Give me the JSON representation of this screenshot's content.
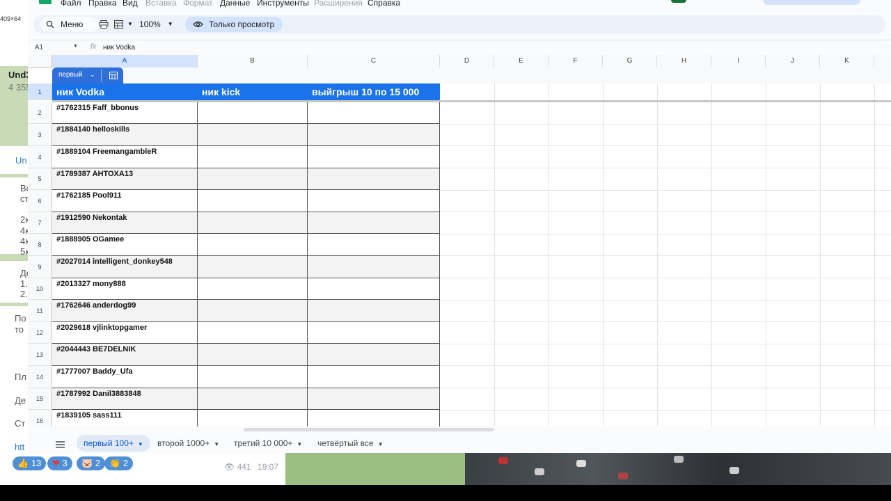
{
  "menu": [
    "Файл",
    "Правка",
    "Вид",
    "Вставка",
    "Формат",
    "Данные",
    "Инструменты",
    "Расширения",
    "Справка"
  ],
  "menu_disabled": [
    "Вставка",
    "Формат",
    "Расширения"
  ],
  "toolbar": {
    "search_label": "Меню",
    "zoom": "100%",
    "view_only_label": "Только просмотр"
  },
  "formula_bar": {
    "cell_ref": "A1",
    "fx": "fx",
    "value": "ник Vodka"
  },
  "columns": [
    "A",
    "B",
    "C",
    "D",
    "E",
    "F",
    "G",
    "H",
    "I",
    "J",
    "K"
  ],
  "table_chip": {
    "label": "первый"
  },
  "header": {
    "col_a": "ник Vodka",
    "col_b": "ник kick",
    "col_c": "выйгрыш 10 по 15 000"
  },
  "rows": [
    {
      "n": "1"
    },
    {
      "n": "2",
      "a": "#1762315 Faff_bbonus"
    },
    {
      "n": "3",
      "a": "#1884140 helloskills"
    },
    {
      "n": "4",
      "a": "#1889104 FreemangambleR"
    },
    {
      "n": "5",
      "a": "#1789387 AHTOXA13"
    },
    {
      "n": "6",
      "a": "#1762185 Pool911"
    },
    {
      "n": "7",
      "a": "#1912590 Nekontak"
    },
    {
      "n": "8",
      "a": "#1888905 OGamee"
    },
    {
      "n": "9",
      "a": "#2027014 intelligent_donkey548"
    },
    {
      "n": "10",
      "a": "#2013327 mony888"
    },
    {
      "n": "11",
      "a": "#1762646 anderdog99"
    },
    {
      "n": "12",
      "a": "#2029618 vjlinktopgamer"
    },
    {
      "n": "13",
      "a": "#2044443 BE7DELNIK"
    },
    {
      "n": "14",
      "a": "#1777007 Baddy_Ufa"
    },
    {
      "n": "15",
      "a": "#1787992 Danil3883848"
    },
    {
      "n": "16",
      "a": "#1839105 sass111"
    }
  ],
  "sheet_tabs": [
    "первый 100+",
    "второй 1000+",
    "третий 10 000+",
    "четвёртый все"
  ],
  "background": {
    "top_left": "409×64",
    "chat_title": "Und3",
    "chat_sub": "4 355",
    "link_fragment": "Un",
    "msg_lines": [
      "Вс",
      "ст",
      "2к",
      "4к",
      "4к",
      "5к",
      "Де",
      "1.",
      "2."
    ],
    "msg2": [
      "По",
      "то"
    ],
    "msg3": [
      "Пл",
      "Де",
      "Ст"
    ],
    "link": "htt",
    "reactions": [
      {
        "icon": "👍",
        "count": "13"
      },
      {
        "icon": "❤",
        "count": "3"
      },
      {
        "icon": "🐷",
        "count": "2"
      },
      {
        "icon": "👏",
        "count": "2"
      }
    ],
    "views": "441",
    "time": "19:07"
  }
}
